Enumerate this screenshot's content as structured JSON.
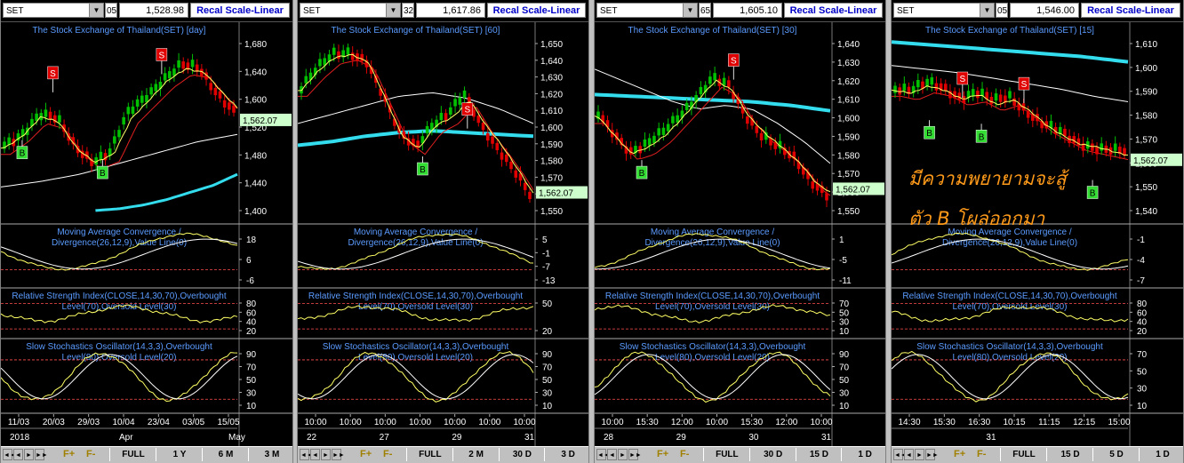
{
  "colors": {
    "bg": "#000000",
    "candle_up": "#00c000",
    "candle_down": "#e00000",
    "ma_fast": "#ffff66",
    "ma_mid": "#e02020",
    "ma_slow": "#ffffff",
    "ma_long": "#33ddee",
    "title": "#5b9bff",
    "signal_sell": "#e00000",
    "signal_buy": "#33dd33",
    "overlevel": "#ff5050",
    "last_price_bg": "#ccffcc"
  },
  "annotation": {
    "line1": "มีความพยายามจะสู้",
    "line2": "ตัว B โผล่ออกมา"
  },
  "panes": [
    {
      "symbol": "SET",
      "field_stub": "05",
      "price": "1,528.98",
      "recal": "Recal Scale-Linear",
      "title": "The Stock Exchange of Thailand(SET) [day]",
      "last": "1,562.07",
      "price_ticks": [
        "1,680",
        "1,640",
        "1,600",
        "1,520",
        "1,480",
        "1,440",
        "1,400"
      ],
      "macd_title": [
        "Moving Average Convergence /",
        "Divergence(26,12,9),Value Line(0)"
      ],
      "macd_ticks": [
        "18",
        "6",
        "-6"
      ],
      "rsi_title": [
        "Relative Strength Index(CLOSE,14,30,70),Overbought",
        "Level(70),Oversold Level(30)"
      ],
      "rsi_ticks": [
        "80",
        "60",
        "40",
        "20"
      ],
      "sto_title": [
        "Slow Stochastics Oscillator(14,3,3),Overbought",
        "Level(80),Oversold Level(20)"
      ],
      "sto_ticks": [
        "90",
        "70",
        "50",
        "30",
        "10"
      ],
      "date_row1": [
        "11/03",
        "20/03",
        "29/03",
        "10/04",
        "23/04",
        "03/05",
        "15/05"
      ],
      "date_row2": [
        "2018",
        "Apr",
        "May"
      ],
      "f_plus": "F+",
      "f_minus": "F-",
      "ranges": [
        "FULL",
        "1 Y",
        "6 M",
        "3 M"
      ],
      "signals": [
        {
          "t": "S"
        },
        {
          "t": "S"
        },
        {
          "t": "B"
        },
        {
          "t": "B"
        }
      ]
    },
    {
      "symbol": "SET",
      "field_stub": "32",
      "price": "1,617.86",
      "recal": "Recal Scale-Linear",
      "title": "The Stock Exchange of Thailand(SET) [60]",
      "last": "1,562.07",
      "price_ticks": [
        "1,650",
        "1,640",
        "1,630",
        "1,620",
        "1,610",
        "1,600",
        "1,590",
        "1,580",
        "1,570",
        "1,560",
        "1,550"
      ],
      "macd_title": [
        "Moving Average Convergence /",
        "Divergence(26,12,9),Value Line(0)"
      ],
      "macd_ticks": [
        "5",
        "-1",
        "-7",
        "-13"
      ],
      "rsi_title": [
        "Relative Strength Index(CLOSE,14,30,70),Overbought",
        "Level(70),Oversold Level(30)"
      ],
      "rsi_ticks": [
        "50",
        "20"
      ],
      "sto_title": [
        "Slow Stochastics Oscillator(14,3,3),Overbought",
        "Level(80),Oversold Level(20)"
      ],
      "sto_ticks": [
        "90",
        "70",
        "50",
        "30",
        "10"
      ],
      "date_row1": [
        "10:00",
        "10:00",
        "10:00",
        "10:00",
        "10:00",
        "10:00",
        "10:00"
      ],
      "date_row2": [
        "22",
        "27",
        "29",
        "31"
      ],
      "f_plus": "F+",
      "f_minus": "F-",
      "ranges": [
        "FULL",
        "2 M",
        "30 D",
        "3 D"
      ],
      "signals": [
        {
          "t": "S"
        },
        {
          "t": "B"
        }
      ]
    },
    {
      "symbol": "SET",
      "field_stub": "65",
      "price": "1,605.10",
      "recal": "Recal Scale-Linear",
      "title": "The Stock Exchange of Thailand(SET) [30]",
      "last": "1,562.07",
      "price_ticks": [
        "1,640",
        "1,630",
        "1,620",
        "1,610",
        "1,600",
        "1,590",
        "1,580",
        "1,570",
        "1,560",
        "1,550"
      ],
      "macd_title": [
        "Moving Average Convergence /",
        "Divergence(26,12,9),Value Line(0)"
      ],
      "macd_ticks": [
        "1",
        "-5",
        "-11"
      ],
      "rsi_title": [
        "Relative Strength Index(CLOSE,14,30,70),Overbought",
        "Level(70),Oversold Level(30)"
      ],
      "rsi_ticks": [
        "70",
        "50",
        "30",
        "10"
      ],
      "sto_title": [
        "Slow Stochastics Oscillator(14,3,3),Overbought",
        "Level(80),Oversold Level(20)"
      ],
      "sto_ticks": [
        "90",
        "70",
        "50",
        "30",
        "10"
      ],
      "date_row1": [
        "10:00",
        "15:30",
        "12:00",
        "10:00",
        "15:30",
        "12:00",
        "10:00"
      ],
      "date_row2": [
        "28",
        "29",
        "30",
        "31"
      ],
      "f_plus": "F+",
      "f_minus": "F-",
      "ranges": [
        "FULL",
        "30 D",
        "15 D",
        "1 D"
      ],
      "signals": [
        {
          "t": "S"
        },
        {
          "t": "B"
        }
      ]
    },
    {
      "symbol": "SET",
      "field_stub": "05",
      "price": "1,546.00",
      "recal": "Recal Scale-Linear",
      "title": "The Stock Exchange of Thailand(SET) [15]",
      "last": "1,562.07",
      "price_ticks": [
        "1,610",
        "1,600",
        "1,590",
        "1,580",
        "1,570",
        "1,560",
        "1,550",
        "1,540"
      ],
      "macd_title": [
        "Moving Average Convergence /",
        "Divergence(26,12,9),Value Line(0)"
      ],
      "macd_ticks": [
        "-1",
        "-4",
        "-7"
      ],
      "rsi_title": [
        "Relative Strength Index(CLOSE,14,30,70),Overbought",
        "Level(70),Oversold Level(30)"
      ],
      "rsi_ticks": [
        "80",
        "60",
        "40",
        "20"
      ],
      "sto_title": [
        "Slow Stochastics Oscillator(14,3,3),Overbought",
        "Level(80),Oversold Level(20)"
      ],
      "sto_ticks": [
        "70",
        "50",
        "30",
        "10"
      ],
      "date_row1": [
        "14:30",
        "15:30",
        "16:30",
        "10:15",
        "11:15",
        "12:15",
        "15:00"
      ],
      "date_row2": [
        "31"
      ],
      "f_plus": "F+",
      "f_minus": "F-",
      "ranges": [
        "FULL",
        "15 D",
        "5 D",
        "1 D"
      ],
      "signals": [
        {
          "t": "S"
        },
        {
          "t": "S"
        },
        {
          "t": "B"
        },
        {
          "t": "B"
        },
        {
          "t": "B"
        }
      ]
    }
  ]
}
